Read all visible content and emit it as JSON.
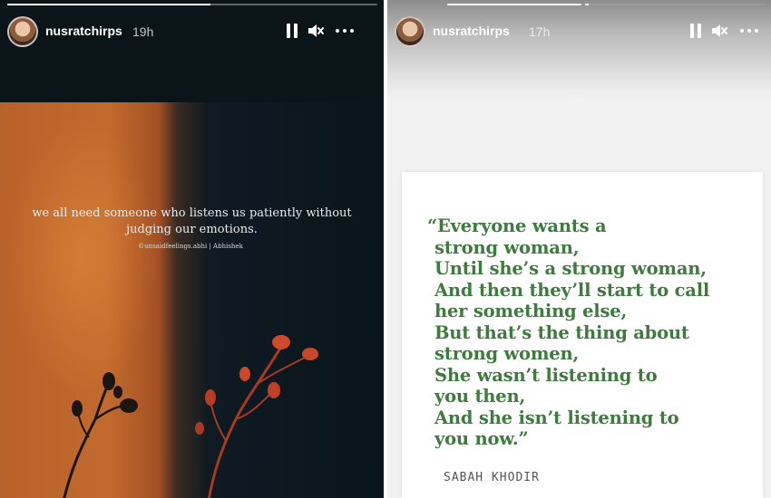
{
  "left_story": {
    "username": "nusratchirps",
    "time": "19h",
    "progress": 0.55,
    "quote": "we all need someone who listens us patiently without judging our emotions.",
    "credit": "©unsaidfeelings.abhi | Abhishek"
  },
  "right_story": {
    "username": "nusratchirps",
    "time": "17h",
    "progress_first": 1.0,
    "progress_second": 0.02,
    "quote_lines": [
      "“Everyone wants a",
      "strong woman,",
      "Until she’s a strong woman,",
      "And then they’ll start to call",
      "her something else,",
      "But that’s the thing about",
      "strong women,",
      "She wasn’t listening to",
      "you then,",
      "And she isn’t listening to",
      "you now.”"
    ],
    "author": "SABAH KHODIR"
  },
  "icons": {
    "pause": "pause-icon",
    "mute": "mute-icon",
    "more": "more-icon"
  },
  "colors": {
    "quote_green": "#3f7a3f",
    "accent_orange": "#c16a2e"
  }
}
